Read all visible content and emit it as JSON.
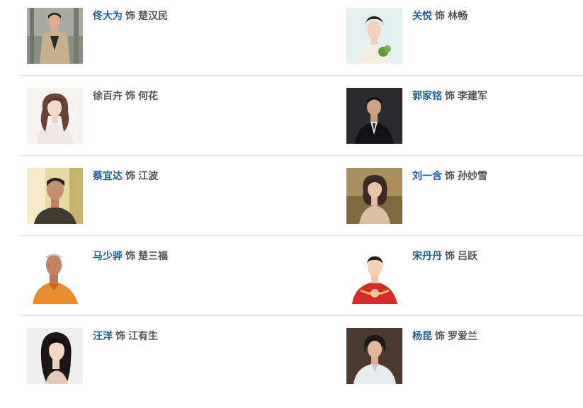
{
  "separator": "饰",
  "rows": [
    {
      "left": {
        "actor": "佟大为",
        "role": "楚汉民",
        "linked": true
      },
      "right": {
        "actor": "关悦",
        "role": "林畅",
        "linked": true
      }
    },
    {
      "left": {
        "actor": "徐百卉",
        "role": "何花",
        "linked": false
      },
      "right": {
        "actor": "郭家铭",
        "role": "李建军",
        "linked": true
      }
    },
    {
      "left": {
        "actor": "蔡宜达",
        "role": "江波",
        "linked": true
      },
      "right": {
        "actor": "刘一含",
        "role": "孙妙雪",
        "linked": true
      }
    },
    {
      "left": {
        "actor": "马少骅",
        "role": "楚三福",
        "linked": true
      },
      "right": {
        "actor": "宋丹丹",
        "role": "吕跃",
        "linked": true
      }
    },
    {
      "left": {
        "actor": "汪洋",
        "role": "江有生",
        "linked": true
      },
      "right": {
        "actor": "杨昆",
        "role": "罗爱兰",
        "linked": true
      }
    }
  ]
}
